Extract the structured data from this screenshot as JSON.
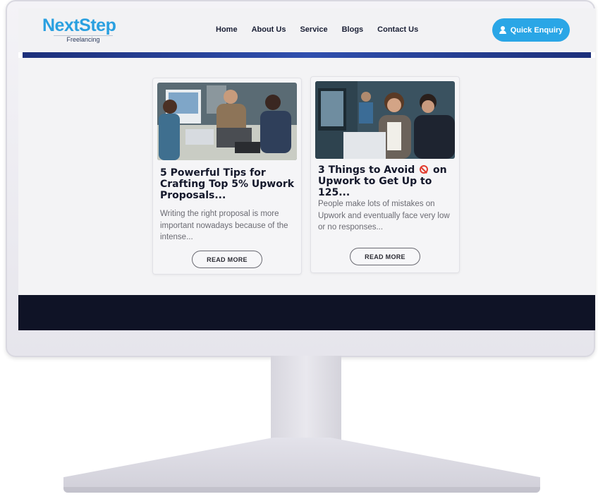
{
  "brand": {
    "name": "NextStep",
    "tagline": "Freelancing"
  },
  "nav": {
    "items": [
      {
        "label": "Home"
      },
      {
        "label": "About Us"
      },
      {
        "label": "Service"
      },
      {
        "label": "Blogs"
      },
      {
        "label": "Contact Us"
      }
    ]
  },
  "header": {
    "enquiry_label": "Quick Enquiry"
  },
  "colors": {
    "accent": "#2aa6e6",
    "nav_bar": "#1c2f7a",
    "footer": "#0f1326"
  },
  "posts": [
    {
      "title": "5 Powerful Tips for Crafting Top 5% Upwork Proposals...",
      "excerpt": "Writing the right proposal is more important nowadays because of the intense...",
      "button": "READ MORE"
    },
    {
      "title_before_icon": "3 Things to Avoid",
      "title_after_icon": "on Upwork to Get Up to 125...",
      "excerpt": "People make lots of mistakes on Upwork and eventually face very low or no responses...",
      "button": "READ MORE"
    }
  ]
}
